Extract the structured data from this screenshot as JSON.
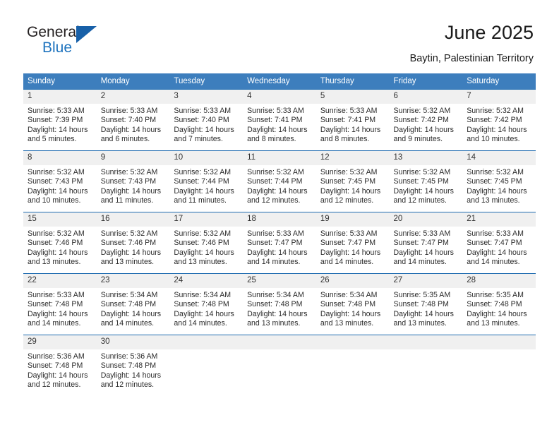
{
  "logo": {
    "word_one": "General",
    "word_two": "Blue",
    "triangle_color": "#1860a8",
    "blue_color": "#1e73be"
  },
  "header": {
    "title": "June 2025",
    "location": "Baytin, Palestinian Territory"
  },
  "theme": {
    "header_bg": "#3d7ebd",
    "row_border": "#1e6bb0",
    "daynum_bg": "#f0f0f0"
  },
  "weekday_headers": [
    "Sunday",
    "Monday",
    "Tuesday",
    "Wednesday",
    "Thursday",
    "Friday",
    "Saturday"
  ],
  "weeks": [
    {
      "days": [
        {
          "n": "1",
          "sunrise": "Sunrise: 5:33 AM",
          "sunset": "Sunset: 7:39 PM",
          "daylight1": "Daylight: 14 hours",
          "daylight2": "and 5 minutes."
        },
        {
          "n": "2",
          "sunrise": "Sunrise: 5:33 AM",
          "sunset": "Sunset: 7:40 PM",
          "daylight1": "Daylight: 14 hours",
          "daylight2": "and 6 minutes."
        },
        {
          "n": "3",
          "sunrise": "Sunrise: 5:33 AM",
          "sunset": "Sunset: 7:40 PM",
          "daylight1": "Daylight: 14 hours",
          "daylight2": "and 7 minutes."
        },
        {
          "n": "4",
          "sunrise": "Sunrise: 5:33 AM",
          "sunset": "Sunset: 7:41 PM",
          "daylight1": "Daylight: 14 hours",
          "daylight2": "and 8 minutes."
        },
        {
          "n": "5",
          "sunrise": "Sunrise: 5:33 AM",
          "sunset": "Sunset: 7:41 PM",
          "daylight1": "Daylight: 14 hours",
          "daylight2": "and 8 minutes."
        },
        {
          "n": "6",
          "sunrise": "Sunrise: 5:32 AM",
          "sunset": "Sunset: 7:42 PM",
          "daylight1": "Daylight: 14 hours",
          "daylight2": "and 9 minutes."
        },
        {
          "n": "7",
          "sunrise": "Sunrise: 5:32 AM",
          "sunset": "Sunset: 7:42 PM",
          "daylight1": "Daylight: 14 hours",
          "daylight2": "and 10 minutes."
        }
      ]
    },
    {
      "days": [
        {
          "n": "8",
          "sunrise": "Sunrise: 5:32 AM",
          "sunset": "Sunset: 7:43 PM",
          "daylight1": "Daylight: 14 hours",
          "daylight2": "and 10 minutes."
        },
        {
          "n": "9",
          "sunrise": "Sunrise: 5:32 AM",
          "sunset": "Sunset: 7:43 PM",
          "daylight1": "Daylight: 14 hours",
          "daylight2": "and 11 minutes."
        },
        {
          "n": "10",
          "sunrise": "Sunrise: 5:32 AM",
          "sunset": "Sunset: 7:44 PM",
          "daylight1": "Daylight: 14 hours",
          "daylight2": "and 11 minutes."
        },
        {
          "n": "11",
          "sunrise": "Sunrise: 5:32 AM",
          "sunset": "Sunset: 7:44 PM",
          "daylight1": "Daylight: 14 hours",
          "daylight2": "and 12 minutes."
        },
        {
          "n": "12",
          "sunrise": "Sunrise: 5:32 AM",
          "sunset": "Sunset: 7:45 PM",
          "daylight1": "Daylight: 14 hours",
          "daylight2": "and 12 minutes."
        },
        {
          "n": "13",
          "sunrise": "Sunrise: 5:32 AM",
          "sunset": "Sunset: 7:45 PM",
          "daylight1": "Daylight: 14 hours",
          "daylight2": "and 12 minutes."
        },
        {
          "n": "14",
          "sunrise": "Sunrise: 5:32 AM",
          "sunset": "Sunset: 7:45 PM",
          "daylight1": "Daylight: 14 hours",
          "daylight2": "and 13 minutes."
        }
      ]
    },
    {
      "days": [
        {
          "n": "15",
          "sunrise": "Sunrise: 5:32 AM",
          "sunset": "Sunset: 7:46 PM",
          "daylight1": "Daylight: 14 hours",
          "daylight2": "and 13 minutes."
        },
        {
          "n": "16",
          "sunrise": "Sunrise: 5:32 AM",
          "sunset": "Sunset: 7:46 PM",
          "daylight1": "Daylight: 14 hours",
          "daylight2": "and 13 minutes."
        },
        {
          "n": "17",
          "sunrise": "Sunrise: 5:32 AM",
          "sunset": "Sunset: 7:46 PM",
          "daylight1": "Daylight: 14 hours",
          "daylight2": "and 13 minutes."
        },
        {
          "n": "18",
          "sunrise": "Sunrise: 5:33 AM",
          "sunset": "Sunset: 7:47 PM",
          "daylight1": "Daylight: 14 hours",
          "daylight2": "and 14 minutes."
        },
        {
          "n": "19",
          "sunrise": "Sunrise: 5:33 AM",
          "sunset": "Sunset: 7:47 PM",
          "daylight1": "Daylight: 14 hours",
          "daylight2": "and 14 minutes."
        },
        {
          "n": "20",
          "sunrise": "Sunrise: 5:33 AM",
          "sunset": "Sunset: 7:47 PM",
          "daylight1": "Daylight: 14 hours",
          "daylight2": "and 14 minutes."
        },
        {
          "n": "21",
          "sunrise": "Sunrise: 5:33 AM",
          "sunset": "Sunset: 7:47 PM",
          "daylight1": "Daylight: 14 hours",
          "daylight2": "and 14 minutes."
        }
      ]
    },
    {
      "days": [
        {
          "n": "22",
          "sunrise": "Sunrise: 5:33 AM",
          "sunset": "Sunset: 7:48 PM",
          "daylight1": "Daylight: 14 hours",
          "daylight2": "and 14 minutes."
        },
        {
          "n": "23",
          "sunrise": "Sunrise: 5:34 AM",
          "sunset": "Sunset: 7:48 PM",
          "daylight1": "Daylight: 14 hours",
          "daylight2": "and 14 minutes."
        },
        {
          "n": "24",
          "sunrise": "Sunrise: 5:34 AM",
          "sunset": "Sunset: 7:48 PM",
          "daylight1": "Daylight: 14 hours",
          "daylight2": "and 14 minutes."
        },
        {
          "n": "25",
          "sunrise": "Sunrise: 5:34 AM",
          "sunset": "Sunset: 7:48 PM",
          "daylight1": "Daylight: 14 hours",
          "daylight2": "and 13 minutes."
        },
        {
          "n": "26",
          "sunrise": "Sunrise: 5:34 AM",
          "sunset": "Sunset: 7:48 PM",
          "daylight1": "Daylight: 14 hours",
          "daylight2": "and 13 minutes."
        },
        {
          "n": "27",
          "sunrise": "Sunrise: 5:35 AM",
          "sunset": "Sunset: 7:48 PM",
          "daylight1": "Daylight: 14 hours",
          "daylight2": "and 13 minutes."
        },
        {
          "n": "28",
          "sunrise": "Sunrise: 5:35 AM",
          "sunset": "Sunset: 7:48 PM",
          "daylight1": "Daylight: 14 hours",
          "daylight2": "and 13 minutes."
        }
      ]
    },
    {
      "days": [
        {
          "n": "29",
          "sunrise": "Sunrise: 5:36 AM",
          "sunset": "Sunset: 7:48 PM",
          "daylight1": "Daylight: 14 hours",
          "daylight2": "and 12 minutes."
        },
        {
          "n": "30",
          "sunrise": "Sunrise: 5:36 AM",
          "sunset": "Sunset: 7:48 PM",
          "daylight1": "Daylight: 14 hours",
          "daylight2": "and 12 minutes."
        },
        {
          "n": "",
          "sunrise": "",
          "sunset": "",
          "daylight1": "",
          "daylight2": "",
          "empty": true
        },
        {
          "n": "",
          "sunrise": "",
          "sunset": "",
          "daylight1": "",
          "daylight2": "",
          "empty": true
        },
        {
          "n": "",
          "sunrise": "",
          "sunset": "",
          "daylight1": "",
          "daylight2": "",
          "empty": true
        },
        {
          "n": "",
          "sunrise": "",
          "sunset": "",
          "daylight1": "",
          "daylight2": "",
          "empty": true
        },
        {
          "n": "",
          "sunrise": "",
          "sunset": "",
          "daylight1": "",
          "daylight2": "",
          "empty": true
        }
      ]
    }
  ]
}
